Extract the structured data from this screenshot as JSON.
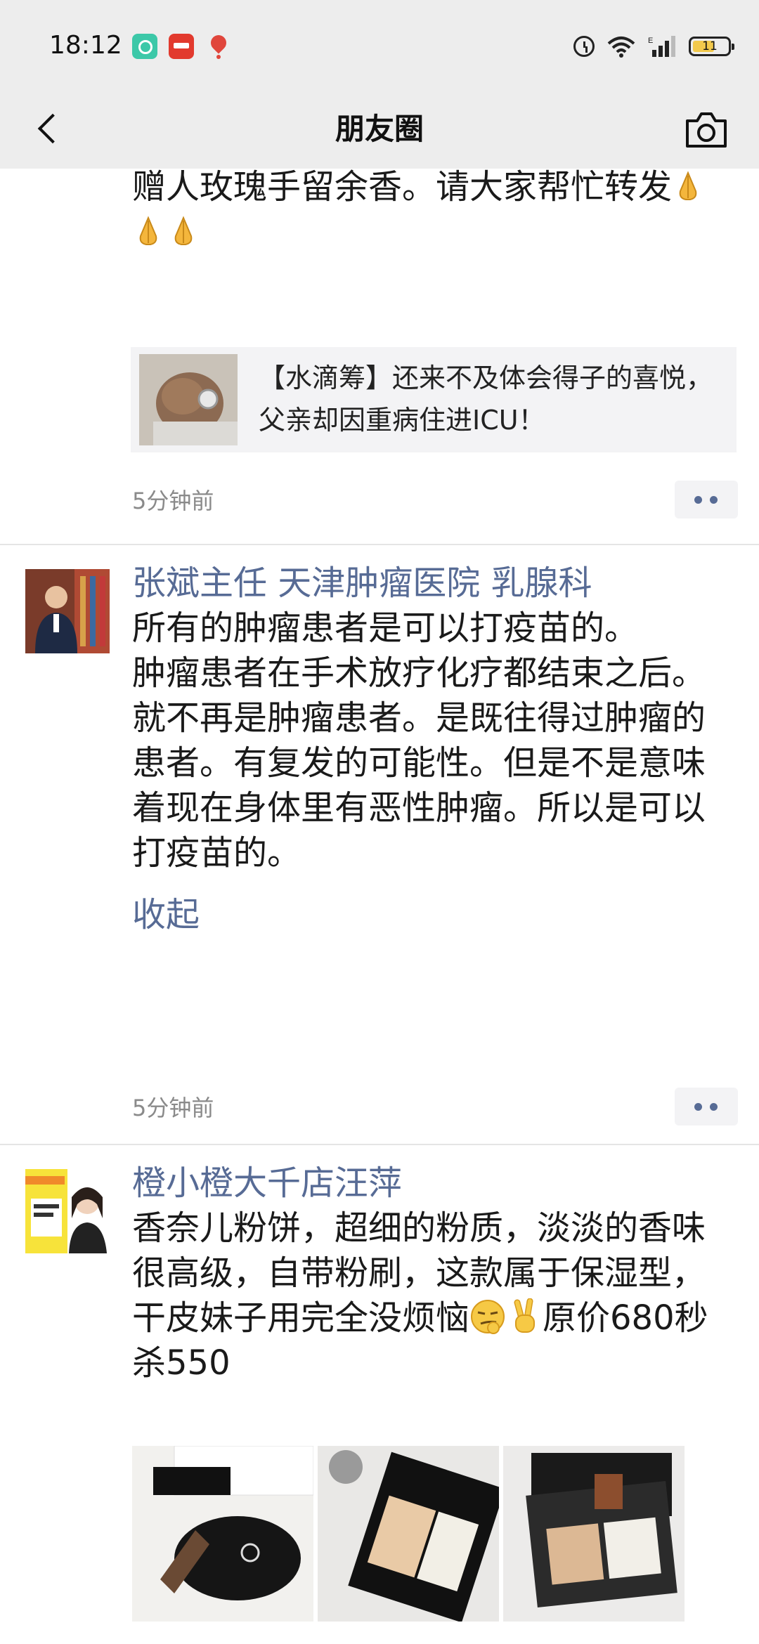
{
  "status_bar": {
    "time": "18:12",
    "battery": "11",
    "icons": [
      "app-notif-icon",
      "app-notif-icon",
      "location-notif-icon",
      "alarm-icon",
      "wifi-icon",
      "signal-icon",
      "battery-icon"
    ]
  },
  "header": {
    "title": "朋友圈",
    "back_icon": "chevron-left-icon",
    "camera_icon": "camera-icon"
  },
  "posts": [
    {
      "text": "我妹妹朋友的父亲，愿好人一生平安！赠人玫瑰手留余香。请大家帮忙转发",
      "emoji": "pray-emoji",
      "link_card": {
        "title": "【水滴筹】还来不及体会得子的喜悦，父亲却因重病住进ICU！"
      },
      "time": "5分钟前"
    },
    {
      "username": "张斌主任 天津肿瘤医院 乳腺科",
      "text": "所有的肿瘤患者是可以打疫苗的。\n肿瘤患者在手术放疗化疗都结束之后。就不再是肿瘤患者。是既往得过肿瘤的患者。有复发的可能性。但是不是意味着现在身体里有恶性肿瘤。所以是可以打疫苗的。",
      "fold_label": "收起",
      "time": "5分钟前"
    },
    {
      "username": "橙小橙大千店汪萍",
      "text_main": "香奈儿粉饼，超细的粉质，淡淡的香味很高级，自带粉刷，这款属于保湿型，干皮妹子用完全没烦恼",
      "text_tail": "原价680秒杀550",
      "emojis": [
        "smirk-emoji",
        "victory-hand-emoji"
      ],
      "images": [
        "compact-powder-photo",
        "compact-powder-photo",
        "compact-powder-photo"
      ]
    }
  ]
}
